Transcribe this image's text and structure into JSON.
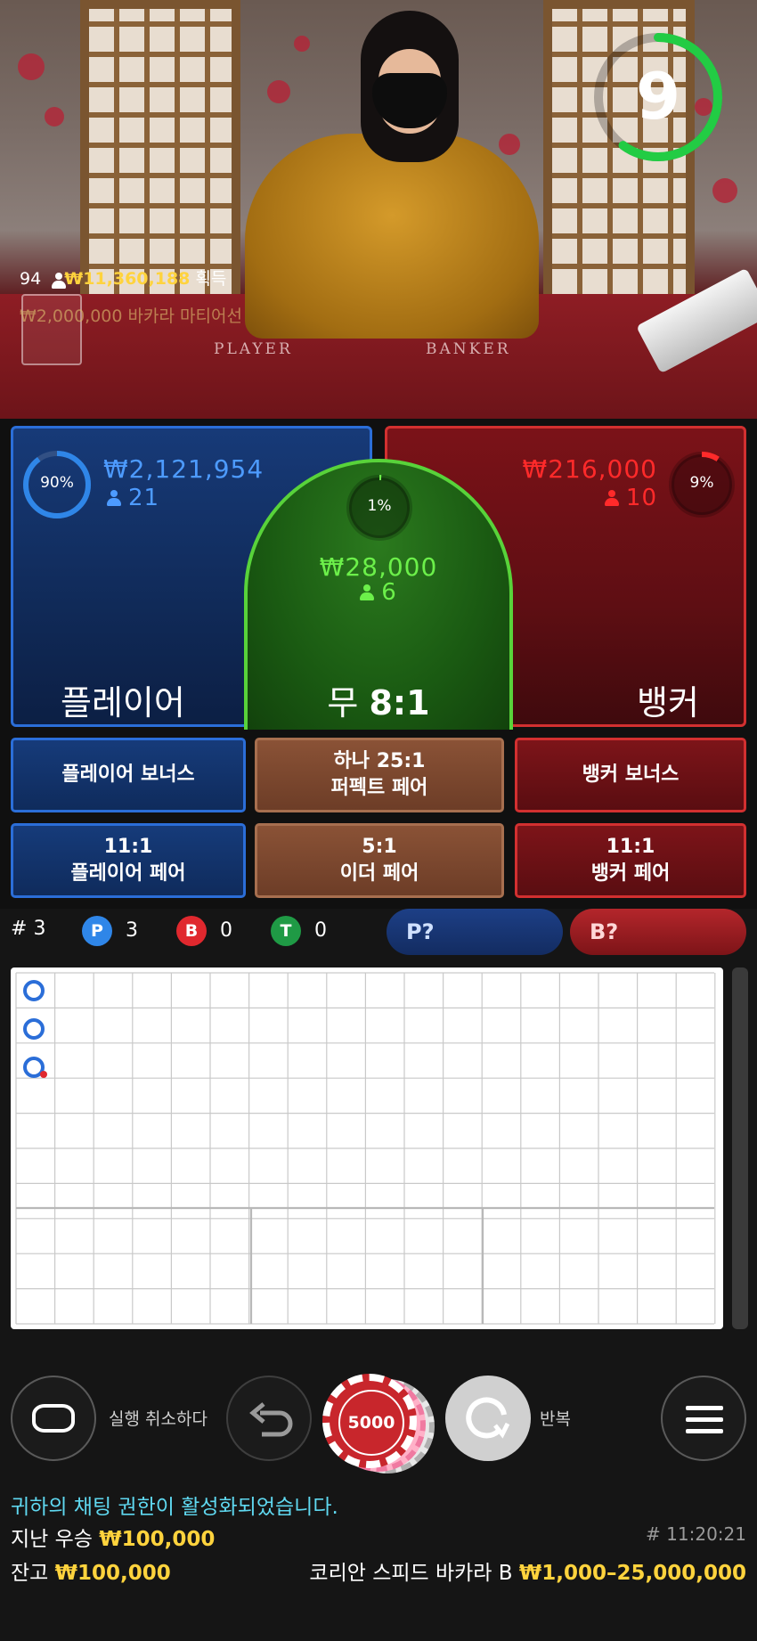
{
  "video": {
    "table_labels": {
      "player": "PLAYER",
      "banker": "BANKER"
    },
    "timer": {
      "seconds": "9",
      "fraction_remaining": 0.6,
      "color": "#22cc44"
    }
  },
  "winners": {
    "count": "94",
    "amount": "₩11,360,188",
    "suffix": "획득",
    "ticker": "₩2,000,000 바카라 마티어선"
  },
  "bets": {
    "player": {
      "percent": "90%",
      "percent_value": 0.9,
      "amount": "₩2,121,954",
      "players": "21",
      "label": "플레이어"
    },
    "tie": {
      "percent": "1%",
      "percent_value": 0.01,
      "amount": "₩28,000",
      "players": "6",
      "label_word": "무",
      "label_odds": "8:1"
    },
    "banker": {
      "percent": "9%",
      "percent_value": 0.09,
      "amount": "₩216,000",
      "players": "10",
      "label": "뱅커"
    }
  },
  "side_bets": {
    "player_bonus": "플레이어 보너스",
    "perfect_pair": {
      "line1": "하나 25:1",
      "line2": "퍼펙트 페어"
    },
    "banker_bonus": "뱅커 보너스",
    "player_pair": {
      "line1": "11:1",
      "line2": "플레이어 페어"
    },
    "either_pair": {
      "line1": "5:1",
      "line2": "이더 페어"
    },
    "banker_pair": {
      "line1": "11:1",
      "line2": "뱅커 페어"
    }
  },
  "stats": {
    "round_prefix": "#",
    "round": "3",
    "p_badge": "P",
    "p_count": "3",
    "b_badge": "B",
    "b_count": "0",
    "t_badge": "T",
    "t_count": "0",
    "p_predict": "P?",
    "b_predict": "B?"
  },
  "road": {
    "results": [
      "P",
      "P",
      "P"
    ],
    "last_has_pair_dot": true
  },
  "controls": {
    "undo_label": "실행 취소하다",
    "chip_value": "5000",
    "repeat_label": "반복"
  },
  "chat": {
    "notice": "귀하의 채팅 권한이 활성화되었습니다.",
    "last_win_label": "지난 우승",
    "last_win_amount": "₩100,000",
    "timestamp": "# 11:20:21",
    "balance_label": "잔고",
    "balance_amount": "₩100,000",
    "game_name": "코리안 스피드 바카라 B",
    "limits": "₩1,000–25,000,000"
  },
  "colors": {
    "player": "#2b6ed8",
    "banker": "#d23030",
    "tie": "#58d33a",
    "gold": "#ffd33d",
    "chat_notice": "#5fd8f0"
  }
}
